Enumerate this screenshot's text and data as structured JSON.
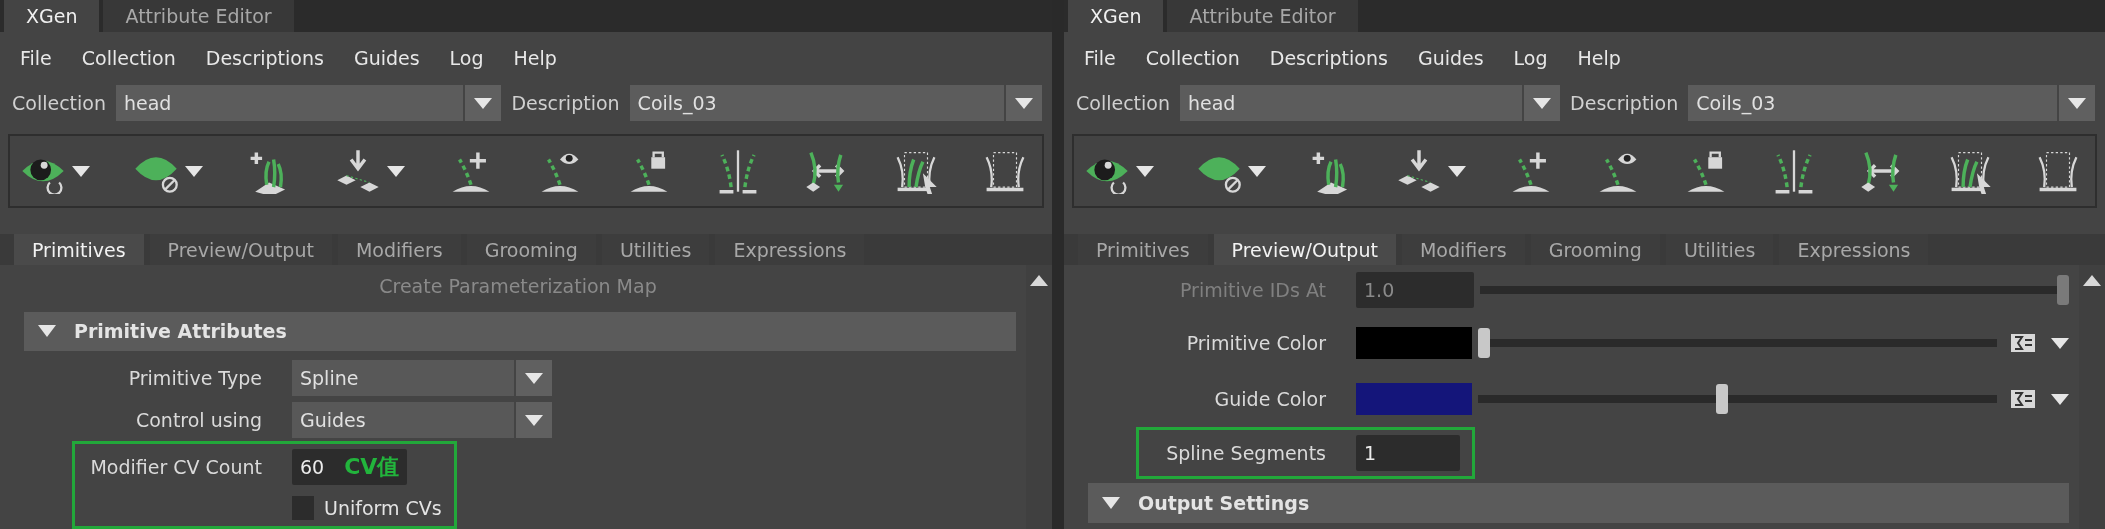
{
  "panels": [
    {
      "window_tabs": [
        {
          "label": "XGen",
          "selected": true
        },
        {
          "label": "Attribute Editor",
          "selected": false
        }
      ],
      "menu": [
        "File",
        "Collection",
        "Descriptions",
        "Guides",
        "Log",
        "Help"
      ],
      "collection": {
        "label": "Collection",
        "value": "head"
      },
      "description": {
        "label": "Description",
        "value": "Coils_03"
      },
      "toolbar": [
        {
          "dropdown": true
        },
        {
          "dropdown": true
        },
        {
          "dropdown": false
        },
        {
          "dropdown": true
        },
        {
          "dropdown": false
        },
        {
          "dropdown": false
        },
        {
          "dropdown": false
        },
        {
          "dropdown": false
        },
        {
          "dropdown": false
        },
        {
          "dropdown": false
        },
        {
          "dropdown": false
        }
      ],
      "tabs": [
        {
          "label": "Primitives",
          "selected": true
        },
        {
          "label": "Preview/Output",
          "selected": false
        },
        {
          "label": "Modifiers",
          "selected": false
        },
        {
          "label": "Grooming",
          "selected": false
        },
        {
          "label": "Utilities",
          "selected": false
        },
        {
          "label": "Expressions",
          "selected": false
        }
      ],
      "rows": [
        {
          "kind": "button",
          "label": "Create Parameterization Map",
          "disabled": true
        },
        {
          "kind": "section",
          "label": "Primitive Attributes",
          "expanded": true
        },
        {
          "kind": "dropdown",
          "label": "Primitive Type",
          "value": "Spline",
          "highlighted": false
        },
        {
          "kind": "dropdown",
          "label": "Control using",
          "value": "Guides",
          "highlighted": false
        },
        {
          "kind": "number",
          "label": "Modifier CV Count",
          "value": "60",
          "annotation": "CV值",
          "disabled": false,
          "highlighted": true
        },
        {
          "kind": "checkbox",
          "label": "Uniform CVs",
          "checked": false,
          "highlighted": true
        }
      ]
    },
    {
      "window_tabs": [
        {
          "label": "XGen",
          "selected": true
        },
        {
          "label": "Attribute Editor",
          "selected": false
        }
      ],
      "menu": [
        "File",
        "Collection",
        "Descriptions",
        "Guides",
        "Log",
        "Help"
      ],
      "collection": {
        "label": "Collection",
        "value": "head"
      },
      "description": {
        "label": "Description",
        "value": "Coils_03"
      },
      "toolbar": [
        {
          "dropdown": true
        },
        {
          "dropdown": true
        },
        {
          "dropdown": false
        },
        {
          "dropdown": true
        },
        {
          "dropdown": false
        },
        {
          "dropdown": false
        },
        {
          "dropdown": false
        },
        {
          "dropdown": false
        },
        {
          "dropdown": false
        },
        {
          "dropdown": false
        },
        {
          "dropdown": false
        }
      ],
      "tabs": [
        {
          "label": "Primitives",
          "selected": false
        },
        {
          "label": "Preview/Output",
          "selected": true
        },
        {
          "label": "Modifiers",
          "selected": false
        },
        {
          "label": "Grooming",
          "selected": false
        },
        {
          "label": "Utilities",
          "selected": false
        },
        {
          "label": "Expressions",
          "selected": false
        }
      ],
      "rows": [
        {
          "kind": "number-slider",
          "label": "Primitive IDs At",
          "value": "1.0",
          "level": 1,
          "disabled": true,
          "highlighted": false
        },
        {
          "kind": "color-slider",
          "label": "Primitive Color",
          "color": "#000000",
          "level": 0,
          "highlighted": false
        },
        {
          "kind": "color-slider",
          "label": "Guide Color",
          "color": "#14157a",
          "level": 0.47,
          "highlighted": false
        },
        {
          "kind": "number",
          "label": "Spline Segments",
          "value": "1",
          "disabled": false,
          "highlighted": true
        },
        {
          "kind": "section",
          "label": "Output Settings",
          "expanded": true
        }
      ]
    }
  ]
}
